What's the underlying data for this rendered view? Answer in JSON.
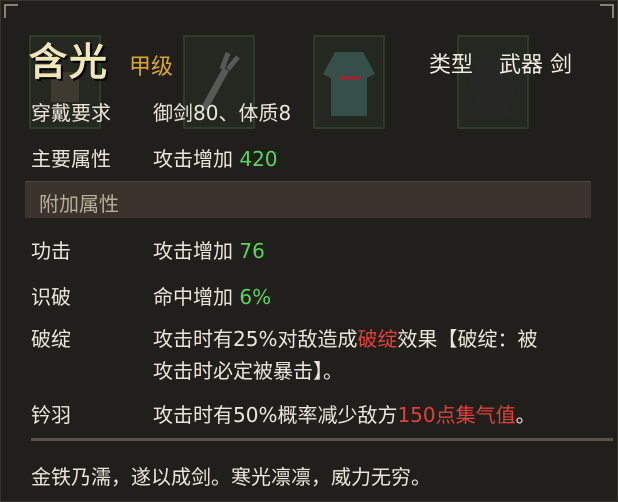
{
  "item": {
    "name": "含光",
    "grade": "甲级",
    "type_label": "类型",
    "type_value": "武器 剑"
  },
  "requirements": {
    "label": "穿戴要求",
    "value": "御剑80、体质8"
  },
  "main_attr": {
    "label": "主要属性",
    "text": "攻击增加",
    "number": "420"
  },
  "section_title": "附加属性",
  "extra_attrs": [
    {
      "label": "功击",
      "text": "攻击增加",
      "number": "76"
    },
    {
      "label": "识破",
      "text": "命中增加",
      "number": "6%"
    }
  ],
  "specials": [
    {
      "label": "破绽",
      "line1_pre": "攻击时有25%对敌造成",
      "line1_red": "破绽",
      "line1_post": "效果【破绽：被",
      "line2": "攻击时必定被暴击】。"
    },
    {
      "label": "钤羽",
      "line1_pre": "攻击时有50%概率减少敌方",
      "line1_red": "150点集气值",
      "line1_post": "。"
    }
  ],
  "flavor_text": "金铁乃濡，遂以成剑。寒光凛凛，威力无穷。",
  "colors": {
    "grade": "#d9a630",
    "positive_number": "#5bd45b",
    "highlight_red": "#e0413a"
  },
  "icons": [
    "wrench-icon",
    "robe-icon",
    "dark-armor-icon",
    "item-slot-icon"
  ]
}
